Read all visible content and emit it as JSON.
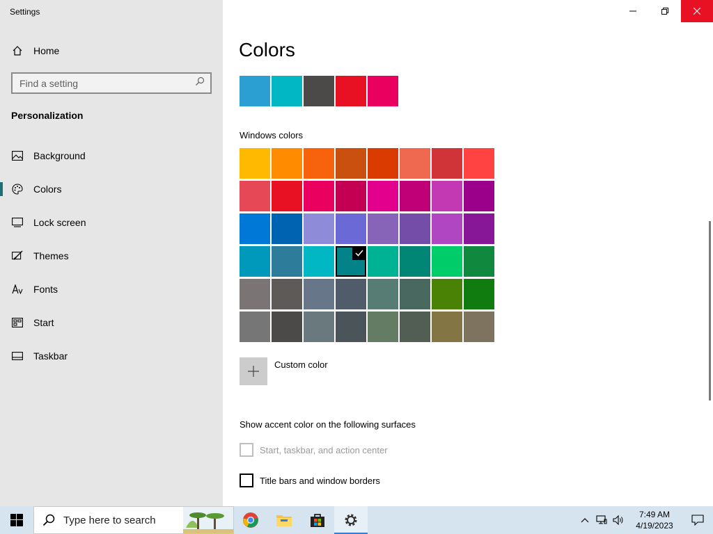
{
  "app": {
    "title": "Settings"
  },
  "sidebar": {
    "home_label": "Home",
    "search_placeholder": "Find a setting",
    "section_title": "Personalization",
    "items": [
      {
        "label": "Background",
        "icon": "image-icon"
      },
      {
        "label": "Colors",
        "icon": "palette-icon",
        "active": true
      },
      {
        "label": "Lock screen",
        "icon": "lock-screen-icon"
      },
      {
        "label": "Themes",
        "icon": "themes-icon"
      },
      {
        "label": "Fonts",
        "icon": "fonts-icon"
      },
      {
        "label": "Start",
        "icon": "start-icon"
      },
      {
        "label": "Taskbar",
        "icon": "taskbar-icon"
      }
    ]
  },
  "main": {
    "title": "Colors",
    "recent_colors": [
      "#2b9fd1",
      "#00b7c3",
      "#4c4a48",
      "#e81123",
      "#ea005e"
    ],
    "windows_colors_label": "Windows colors",
    "windows_colors": [
      [
        "#ffb900",
        "#ff8c00",
        "#f7630c",
        "#ca5010",
        "#da3b01",
        "#ef6950",
        "#d13438",
        "#ff4343"
      ],
      [
        "#e74856",
        "#e81123",
        "#ea005e",
        "#c30052",
        "#e3008c",
        "#bf0077",
        "#c239b3",
        "#9a0089"
      ],
      [
        "#0078d7",
        "#0063b1",
        "#8e8cd8",
        "#6b69d6",
        "#8764b8",
        "#744da9",
        "#b146c2",
        "#881798"
      ],
      [
        "#0099bc",
        "#2d7d9a",
        "#00b7c3",
        "#038387",
        "#00b294",
        "#018574",
        "#00cc6a",
        "#10893e"
      ],
      [
        "#7a7574",
        "#5d5a58",
        "#68768a",
        "#515c6b",
        "#567c73",
        "#486860",
        "#498205",
        "#107c10"
      ],
      [
        "#767676",
        "#4c4a48",
        "#69797e",
        "#4a5459",
        "#647c64",
        "#525e54",
        "#847545",
        "#7e735f"
      ]
    ],
    "selected_color": {
      "row": 3,
      "col": 3
    },
    "custom_color_label": "Custom color",
    "accent_surfaces_label": "Show accent color on the following surfaces",
    "checkbox_start": {
      "label": "Start, taskbar, and action center",
      "checked": false,
      "disabled": true
    },
    "checkbox_titlebars": {
      "label": "Title bars and window borders",
      "checked": false,
      "disabled": false
    }
  },
  "taskbar": {
    "search_placeholder": "Type here to search",
    "clock_time": "7:49 AM",
    "clock_date": "4/19/2023"
  }
}
